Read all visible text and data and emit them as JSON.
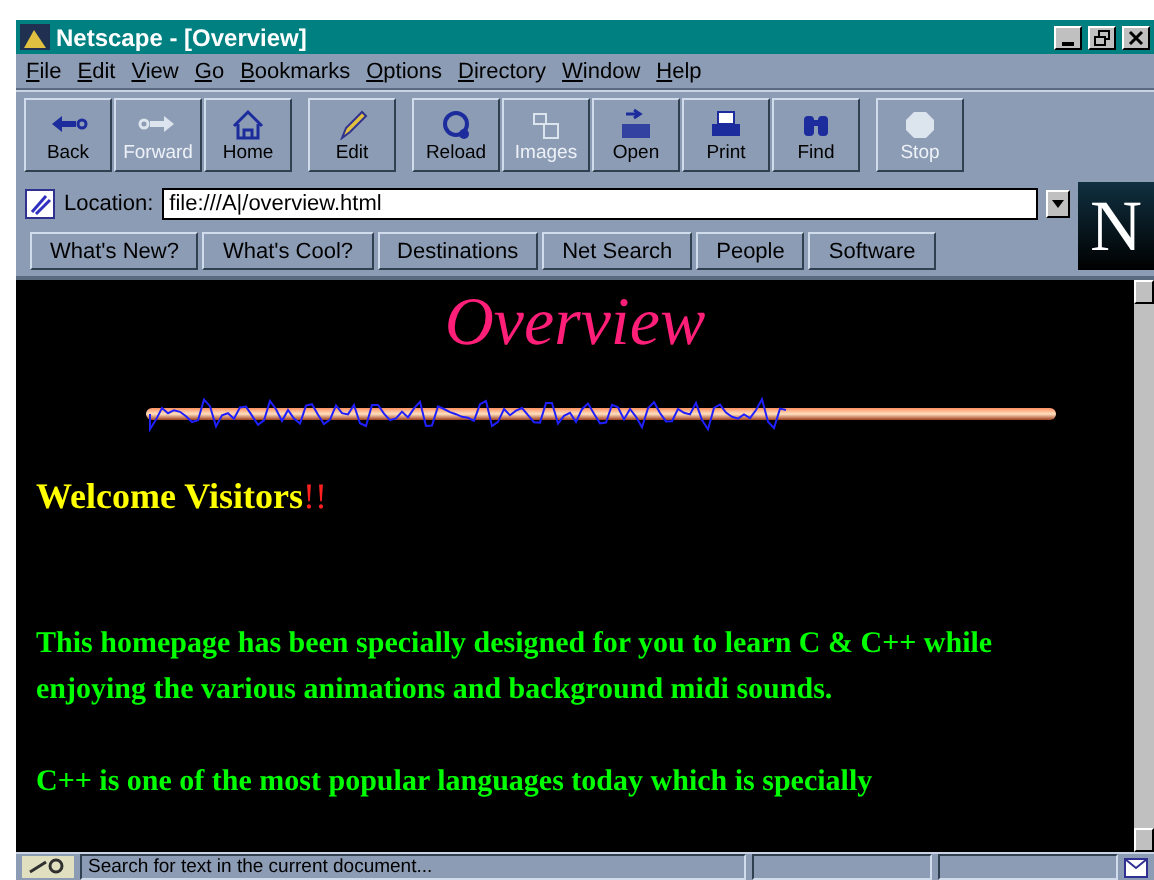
{
  "window": {
    "title": "Netscape - [Overview]"
  },
  "menu": [
    "File",
    "Edit",
    "View",
    "Go",
    "Bookmarks",
    "Options",
    "Directory",
    "Window",
    "Help"
  ],
  "toolbar": {
    "groups": [
      [
        {
          "label": "Back",
          "disabled": false
        },
        {
          "label": "Forward",
          "disabled": true
        },
        {
          "label": "Home",
          "disabled": false
        }
      ],
      [
        {
          "label": "Edit",
          "disabled": false
        }
      ],
      [
        {
          "label": "Reload",
          "disabled": false
        },
        {
          "label": "Images",
          "disabled": true
        },
        {
          "label": "Open",
          "disabled": false
        },
        {
          "label": "Print",
          "disabled": false
        },
        {
          "label": "Find",
          "disabled": false
        }
      ],
      [
        {
          "label": "Stop",
          "disabled": true
        }
      ]
    ]
  },
  "location": {
    "label": "Location:",
    "value": "file:///A|/overview.html"
  },
  "logo": {
    "letter": "N"
  },
  "directory_buttons": [
    "What's New?",
    "What's Cool?",
    "Destinations",
    "Net Search",
    "People",
    "Software"
  ],
  "page": {
    "title": "Overview",
    "heading": {
      "text": "Welcome Visitors",
      "suffix": "!!"
    },
    "paragraphs": [
      "This homepage has been specially designed for you to learn C & C++ while enjoying the various animations and background midi sounds.",
      "C++ is one of the most popular languages today which is specially"
    ]
  },
  "status_bar": {
    "message": "Search for text in the current document..."
  }
}
